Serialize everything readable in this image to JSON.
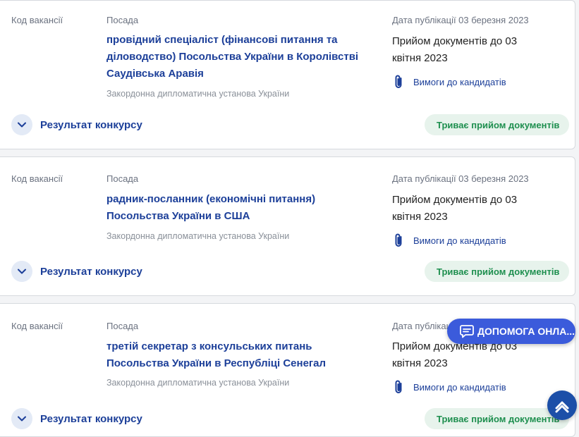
{
  "labels": {
    "code": "Код вакансії",
    "position": "Посада",
    "result": "Результат конкурсу",
    "requirements": "Вимоги до кандидатів"
  },
  "vacancies": [
    {
      "title": "провідний спеціаліст (фінансові питання та діловодство) Посольства України в Королівстві Саудівська Аравія",
      "organization": "Закордонна дипломатична установа України",
      "published": "Дата публікації 03 березня 2023",
      "deadline": "Прийом документів до 03 квітня 2023",
      "status": "Триває прийом документів"
    },
    {
      "title": "радник-посланник (економічні питання) Посольства України в США",
      "organization": "Закордонна дипломатична установа України",
      "published": "Дата публікації 03 березня 2023",
      "deadline": "Прийом документів до 03 квітня 2023",
      "status": "Триває прийом документів"
    },
    {
      "title": "третій секретар з консульських питань Посольства України в Республіці Сенегал",
      "organization": "Закордонна дипломатична установа України",
      "published": "Дата публікації 03 березня 2023",
      "deadline": "Прийом документів до 03 квітня 2023",
      "status": "Триває прийом документів"
    }
  ],
  "help": {
    "label": "ДОПОМОГА ОНЛА...",
    "icon": "chat-icon"
  },
  "scroll_top": {
    "icon": "chevron-up-icon"
  },
  "colors": {
    "link": "#1c3f99",
    "status_text": "#1e8f4f",
    "status_bg": "#e7f3ec",
    "help_bg": "#3b5bdb",
    "scroll_bg": "#1c4fa8"
  }
}
